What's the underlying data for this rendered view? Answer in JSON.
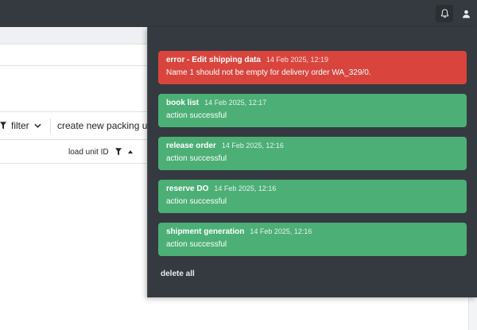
{
  "topbar": {
    "icons": [
      "bell-icon",
      "user-icon"
    ]
  },
  "toolbar": {
    "filter_label": "filter",
    "create_label": "create new packing unit"
  },
  "table": {
    "column_label": "load unit ID"
  },
  "notifications": {
    "items": [
      {
        "type": "error",
        "title": "error - Edit shipping data",
        "time": "14 Feb 2025, 12:19",
        "message": "Name 1 should not be empty for delivery order WA_329/0."
      },
      {
        "type": "success",
        "title": "book list",
        "time": "14 Feb 2025, 12:17",
        "message": "action successful"
      },
      {
        "type": "success",
        "title": "release order",
        "time": "14 Feb 2025, 12:16",
        "message": "action successful"
      },
      {
        "type": "success",
        "title": "reserve DO",
        "time": "14 Feb 2025, 12:16",
        "message": "action successful"
      },
      {
        "type": "success",
        "title": "shipment generation",
        "time": "14 Feb 2025, 12:16",
        "message": "action successful"
      }
    ],
    "delete_all_label": "delete all"
  },
  "colors": {
    "topbar": "#343a40",
    "error": "#d9453d",
    "success": "#4caf76"
  }
}
